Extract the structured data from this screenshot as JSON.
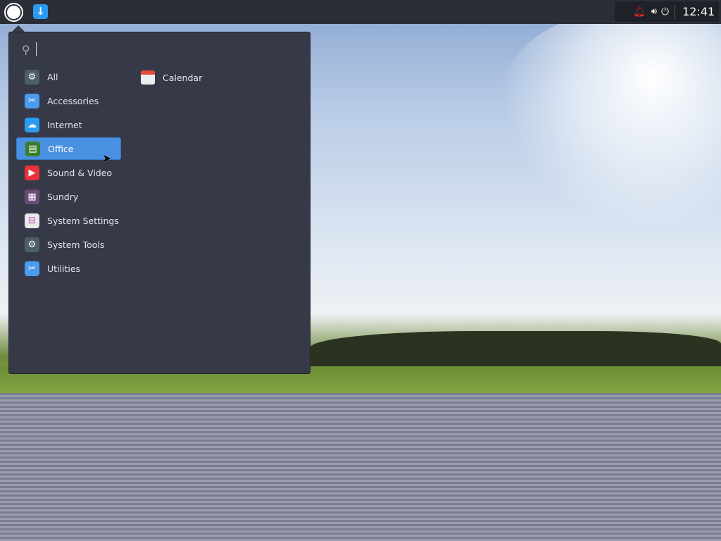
{
  "panel": {
    "clock": "12:41"
  },
  "launcher": {
    "search": {
      "value": "",
      "placeholder": ""
    },
    "categories": [
      {
        "label": "All",
        "icon": "gear-icon",
        "color": "#4d5f6b",
        "glyph": "⚙"
      },
      {
        "label": "Accessories",
        "icon": "scissors-icon",
        "color": "#4a9cef",
        "glyph": "✂"
      },
      {
        "label": "Internet",
        "icon": "cloud-icon",
        "color": "#2a9bf0",
        "glyph": "☁"
      },
      {
        "label": "Office",
        "icon": "document-icon",
        "color": "#3b7d2c",
        "glyph": "▤"
      },
      {
        "label": "Sound & Video",
        "icon": "play-icon",
        "color": "#e8313b",
        "glyph": "▶"
      },
      {
        "label": "Sundry",
        "icon": "grid-icon",
        "color": "#6b4a78",
        "glyph": "▦"
      },
      {
        "label": "System Settings",
        "icon": "toggle-icon",
        "color": "#e8e8e8",
        "glyph": "⊟"
      },
      {
        "label": "System Tools",
        "icon": "gear-icon",
        "color": "#4d5f6b",
        "glyph": "⚙"
      },
      {
        "label": "Utilities",
        "icon": "scissors-icon",
        "color": "#4a9cef",
        "glyph": "✂"
      }
    ],
    "selected": "Office",
    "apps": [
      {
        "label": "Calendar",
        "icon": "calendar-icon"
      }
    ]
  }
}
